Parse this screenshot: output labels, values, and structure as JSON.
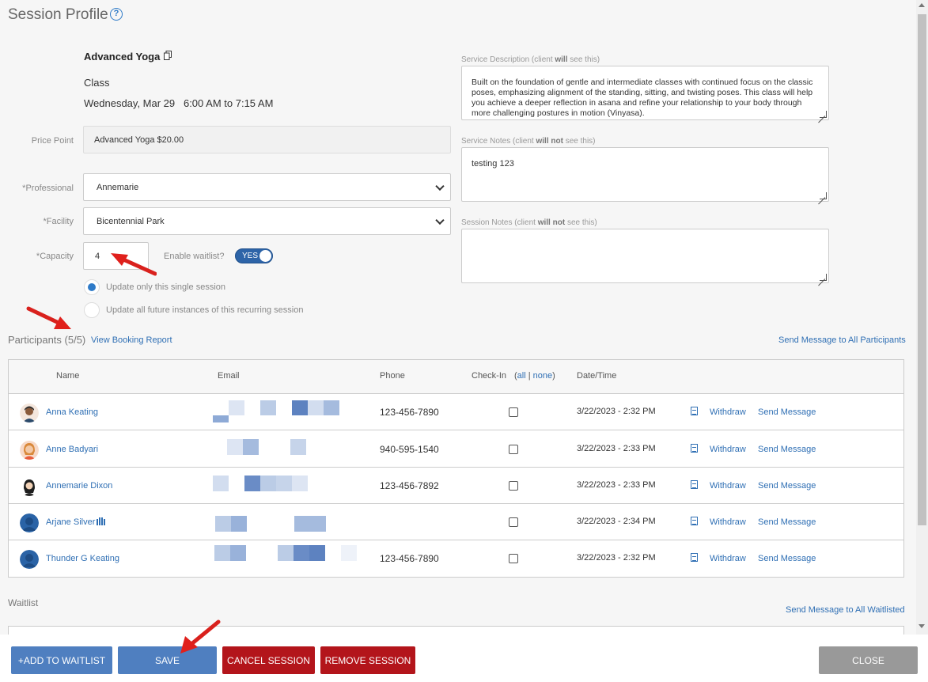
{
  "header": {
    "title": "Session Profile",
    "help_icon": "?"
  },
  "session": {
    "name": "Advanced Yoga",
    "type": "Class",
    "date_time": "Wednesday, Mar 29   6:00 AM to 7:15 AM"
  },
  "form": {
    "price_point": {
      "label": "Price Point",
      "value": "Advanced Yoga $20.00"
    },
    "professional": {
      "label": "*Professional",
      "value": "Annemarie"
    },
    "facility": {
      "label": "*Facility",
      "value": "Bicentennial Park"
    },
    "capacity": {
      "label": "*Capacity",
      "value": "4"
    },
    "waitlist": {
      "label": "Enable waitlist?",
      "toggle_text": "YES",
      "enabled": true
    },
    "update_options": [
      {
        "label": "Update only this single session",
        "selected": true
      },
      {
        "label": "Update all future instances of this recurring session",
        "selected": false
      }
    ]
  },
  "right_panel": {
    "service_description": {
      "label_prefix": "Service Description (client ",
      "label_strong": "will",
      "label_suffix": " see this)",
      "value": "Built on the foundation of gentle and intermediate classes with continued focus on the classic poses, emphasizing alignment of the standing, sitting, and twisting poses. This class will help you achieve a deeper reflection in asana and refine your relationship to your body through more challenging postures in motion (Vinyasa)."
    },
    "service_notes": {
      "label_prefix": "Service Notes (client ",
      "label_strong": "will not",
      "label_suffix": " see this)",
      "value": "testing 123"
    },
    "session_notes": {
      "label_prefix": "Session Notes (client ",
      "label_strong": "will not",
      "label_suffix": " see this)",
      "value": ""
    }
  },
  "participants": {
    "title": "Participants (5/5)",
    "report_link": "View Booking Report",
    "send_all": "Send Message to All Participants",
    "columns": {
      "name": "Name",
      "email": "Email",
      "phone": "Phone",
      "checkin": "Check-In",
      "all": "all",
      "none": "none",
      "date": "Date/Time"
    },
    "rows": [
      {
        "name": "Anna Keating",
        "phone": "123-456-7890",
        "date": "3/22/2023 - 2:32 PM",
        "withdraw": "Withdraw",
        "send": "Send Message"
      },
      {
        "name": "Anne Badyari",
        "phone": "940-595-1540",
        "date": "3/22/2023 - 2:33 PM",
        "withdraw": "Withdraw",
        "send": "Send Message"
      },
      {
        "name": "Annemarie Dixon",
        "phone": "123-456-7892",
        "date": "3/22/2023 - 2:33 PM",
        "withdraw": "Withdraw",
        "send": "Send Message"
      },
      {
        "name": "Arjane Silver",
        "phone": "",
        "date": "3/22/2023 - 2:34 PM",
        "withdraw": "Withdraw",
        "send": "Send Message"
      },
      {
        "name": "Thunder G Keating",
        "phone": "123-456-7890",
        "date": "3/22/2023 - 2:32 PM",
        "withdraw": "Withdraw",
        "send": "Send Message"
      }
    ]
  },
  "waitlist": {
    "title": "Waitlist",
    "send_all": "Send Message to All Waitlisted"
  },
  "footer": {
    "add_waitlist": "+ADD TO WAITLIST",
    "save": "SAVE",
    "cancel_session": "CANCEL SESSION",
    "remove_session": "REMOVE SESSION",
    "close": "CLOSE"
  },
  "colors": {
    "link": "#2f6fb4",
    "primary": "#4f7fc0",
    "danger": "#b3151b",
    "neutral": "#999999",
    "toggle": "#2d64a8"
  }
}
